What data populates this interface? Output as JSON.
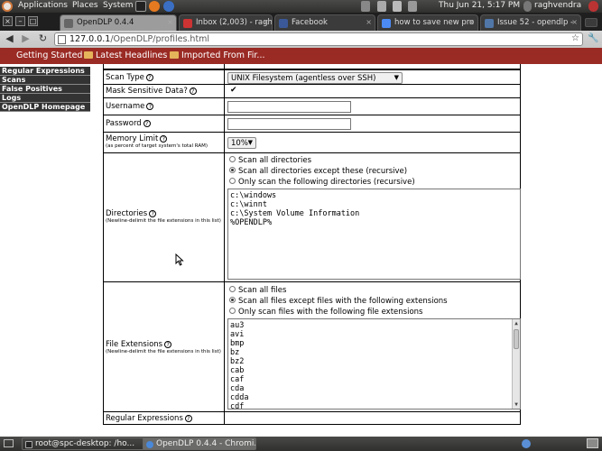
{
  "top_panel": {
    "menus": [
      "Applications",
      "Places",
      "System"
    ],
    "datetime": "Thu Jun 21,  5:17 PM",
    "user": "raghvendra"
  },
  "tabs": [
    {
      "label": "OpenDLP 0.4.4",
      "active": true
    },
    {
      "label": "Inbox (2,003) - ragh"
    },
    {
      "label": "Facebook"
    },
    {
      "label": "how to save new pro"
    },
    {
      "label": "Issue 52 - opendlp -"
    }
  ],
  "address_bar": {
    "host": "127.0.0.1",
    "path": "/OpenDLP/profiles.html"
  },
  "bookmarks": [
    "Getting Started",
    "Latest Headlines",
    "Imported From Fir..."
  ],
  "sidebar": {
    "items": [
      "Regular Expressions",
      "Scans",
      "False Positives",
      "Logs",
      "OpenDLP Homepage"
    ]
  },
  "form": {
    "scan_type_label": "Scan Type",
    "scan_type_value": "UNIX Filesystem (agentless over SSH)",
    "mask_label": "Mask Sensitive Data?",
    "mask_mark": "✔",
    "username_label": "Username",
    "password_label": "Password",
    "memory_label": "Memory Limit",
    "memory_sub": "(as percent of target system's total RAM)",
    "memory_value": "10%",
    "directories_label": "Directories",
    "directories_sub": "(Newline-delimit the file extensions in this list)",
    "dir_options": [
      "Scan all directories",
      "Scan all directories except these (recursive)",
      "Only scan the following directories (recursive)"
    ],
    "dir_list": [
      "c:\\windows",
      "c:\\winnt",
      "c:\\System Volume Information",
      "%OPENDLP%"
    ],
    "ext_label": "File Extensions",
    "ext_sub": "(Newline-delimit the file extensions in this list)",
    "ext_options": [
      "Scan all files",
      "Scan all files except files with the following extensions",
      "Only scan files with the following file extensions"
    ],
    "ext_list": [
      "au3",
      "avi",
      "bmp",
      "bz",
      "bz2",
      "cab",
      "caf",
      "cda",
      "cdda",
      "cdf"
    ],
    "regex_label": "Regular Expressions",
    "help_glyph": "?"
  },
  "taskbar": [
    {
      "label": "root@spc-desktop: /ho..."
    },
    {
      "label": "OpenDLP 0.4.4 - Chromi...",
      "active": true
    }
  ]
}
